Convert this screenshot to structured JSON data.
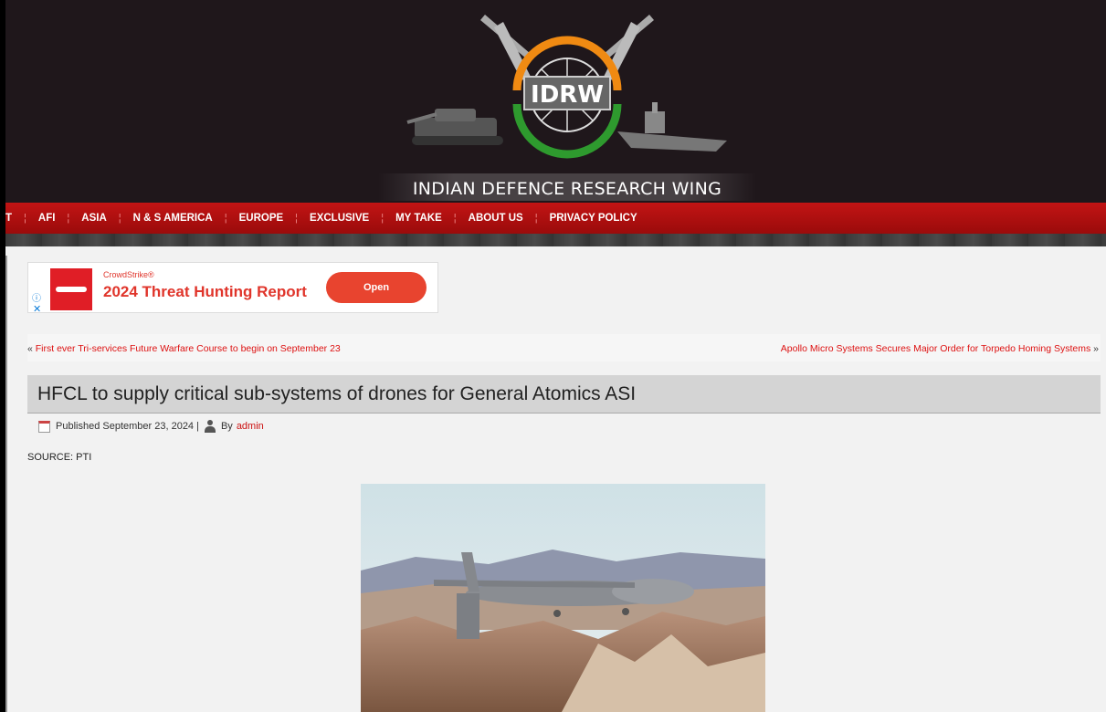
{
  "header": {
    "logo_text": "IDRW",
    "site_name": "INDIAN DEFENCE RESEARCH WING"
  },
  "nav": {
    "items": [
      {
        "label": "T"
      },
      {
        "label": "AFI"
      },
      {
        "label": "ASIA"
      },
      {
        "label": "N & S AMERICA"
      },
      {
        "label": "EUROPE"
      },
      {
        "label": "EXCLUSIVE"
      },
      {
        "label": "MY TAKE"
      },
      {
        "label": "ABOUT US"
      },
      {
        "label": "PRIVACY POLICY"
      }
    ],
    "separator": "¦"
  },
  "ad": {
    "info_icon": "info-icon",
    "close_icon": "close-icon",
    "brand": "CrowdStrike®",
    "title": "2024 Threat Hunting Report",
    "button": "Open",
    "accent": "#e8442f"
  },
  "adjacent": {
    "prev_marker": "«",
    "prev": "First ever Tri-services Future Warfare Course to begin on September 23",
    "next": "Apollo Micro Systems Secures Major Order for Torpedo Homing Systems",
    "next_marker": "»"
  },
  "article": {
    "title": "HFCL to supply critical sub-systems of drones for General Atomics ASI",
    "published": "Published September 23, 2024 |",
    "by": "By",
    "author": "admin",
    "source": "SOURCE: PTI"
  },
  "colors": {
    "nav_red": "#c21414",
    "link_red": "#d11",
    "header_bg": "#1f171b"
  }
}
